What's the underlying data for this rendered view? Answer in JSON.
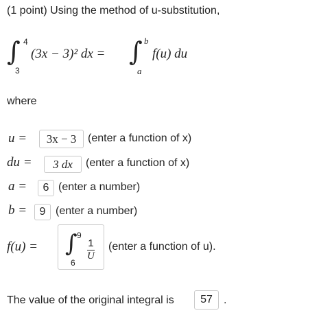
{
  "header": {
    "text": "(1 point) Using the method of u-substitution,"
  },
  "integral": {
    "lower": "3",
    "upper": "4",
    "integrand": "(3x − 3)² dx =",
    "rhs_lower": "a",
    "rhs_upper": "b",
    "rhs_integrand": "f(u) du"
  },
  "where_label": "where",
  "rows": [
    {
      "lhs": "u =",
      "value": "3x − 3",
      "hint": "(enter a function of x)"
    },
    {
      "lhs": "du =",
      "value": "3 dx",
      "hint": "(enter a function of x)"
    },
    {
      "lhs": "a =",
      "value": "6",
      "hint": "(enter a number)"
    },
    {
      "lhs": "b =",
      "value": "9",
      "hint": "(enter a number)"
    }
  ],
  "fu": {
    "lhs": "f(u) =",
    "lower": "6",
    "upper": "9",
    "num": "1",
    "den": "U",
    "hint": "(enter a function of u)."
  },
  "answer": {
    "label": "The value of the original integral is",
    "value": "57",
    "end": "."
  }
}
